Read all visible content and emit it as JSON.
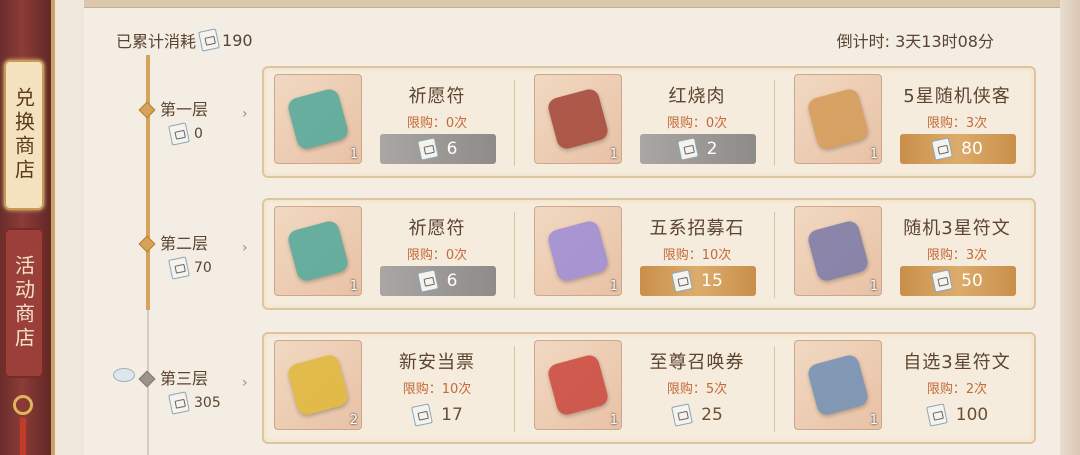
{
  "side_tabs": {
    "exchange": "兑换商店",
    "event": "活动商店"
  },
  "summary": {
    "label": "已累计消耗",
    "value": "190"
  },
  "countdown": "倒计时: 3天13时08分",
  "tiers": [
    {
      "name": "第一层",
      "cost": "0",
      "state": "unlocked"
    },
    {
      "name": "第二层",
      "cost": "70",
      "state": "unlocked"
    },
    {
      "name": "第三层",
      "cost": "305",
      "state": "locked"
    }
  ],
  "rows": [
    [
      {
        "name": "祈愿符",
        "limit": "限购：0次",
        "price": "6",
        "qty": "1",
        "style": "grey",
        "icon": "wish-talisman-icon",
        "color": "#4fa89a"
      },
      {
        "name": "红烧肉",
        "limit": "限购：0次",
        "price": "2",
        "qty": "1",
        "style": "grey",
        "icon": "braised-pork-icon",
        "color": "#a24437"
      },
      {
        "name": "5星随机侠客",
        "limit": "限购：3次",
        "price": "80",
        "qty": "1",
        "style": "gold",
        "icon": "random-hero-bag-icon",
        "color": "#d49b57"
      }
    ],
    [
      {
        "name": "祈愿符",
        "limit": "限购：0次",
        "price": "6",
        "qty": "1",
        "style": "grey",
        "icon": "wish-talisman-icon",
        "color": "#4fa89a"
      },
      {
        "name": "五系招募石",
        "limit": "限购：10次",
        "price": "15",
        "qty": "1",
        "style": "gold",
        "icon": "recruit-stone-icon",
        "color": "#9c8bd6"
      },
      {
        "name": "随机3星符文",
        "limit": "限购：3次",
        "price": "50",
        "qty": "1",
        "style": "gold",
        "icon": "rune-bag-icon",
        "color": "#7a78a8"
      }
    ],
    [
      {
        "name": "新安当票",
        "limit": "限购：10次",
        "price": "17",
        "qty": "2",
        "style": "plain",
        "icon": "pawn-ticket-icon",
        "color": "#e0b838"
      },
      {
        "name": "至尊召唤券",
        "limit": "限购：5次",
        "price": "25",
        "qty": "1",
        "style": "plain",
        "icon": "summon-ticket-icon",
        "color": "#c9463b"
      },
      {
        "name": "自选3星符文",
        "limit": "限购：2次",
        "price": "100",
        "qty": "1",
        "style": "plain",
        "icon": "rune-chest-icon",
        "color": "#6f8fb5"
      }
    ]
  ]
}
